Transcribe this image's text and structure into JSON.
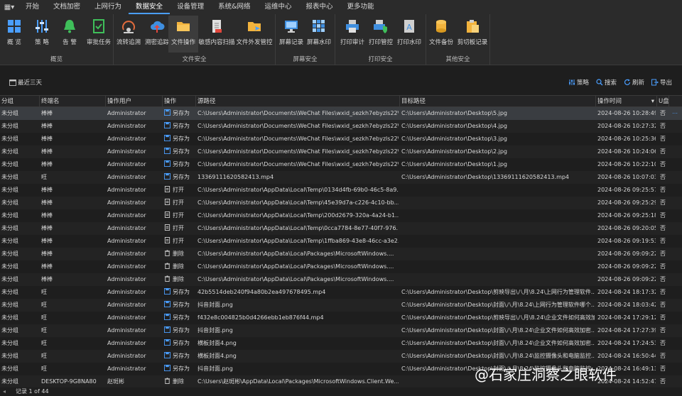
{
  "menu": {
    "items": [
      "开始",
      "文档加密",
      "上网行为",
      "数据安全",
      "设备管理",
      "系统&网络",
      "运维中心",
      "报表中心",
      "更多功能"
    ],
    "active_index": 3
  },
  "ribbon": {
    "groups": [
      {
        "label": "概览",
        "buttons": [
          {
            "label": "概 览",
            "icon": "grid-icon"
          },
          {
            "label": "策 略",
            "icon": "sliders-icon"
          },
          {
            "label": "告 警",
            "icon": "bell-icon"
          },
          {
            "label": "审批任务",
            "icon": "check-doc-icon"
          }
        ]
      },
      {
        "label": "文件安全",
        "buttons": [
          {
            "label": "流转追溯",
            "icon": "trace-icon"
          },
          {
            "label": "溯密追踪",
            "icon": "cloud-upload-icon"
          },
          {
            "label": "文件操作",
            "icon": "folder-icon"
          },
          {
            "label": "敏感内容扫描",
            "icon": "scan-doc-icon"
          },
          {
            "label": "文件外发管控",
            "icon": "folder-send-icon"
          }
        ]
      },
      {
        "label": "屏幕安全",
        "buttons": [
          {
            "label": "屏幕记录",
            "icon": "monitor-icon"
          },
          {
            "label": "屏幕水印",
            "icon": "mosaic-icon"
          }
        ]
      },
      {
        "label": "打印安全",
        "buttons": [
          {
            "label": "打印审计",
            "icon": "printer-icon"
          },
          {
            "label": "打印管控",
            "icon": "printer-shield-icon"
          },
          {
            "label": "打印水印",
            "icon": "doc-a-icon"
          }
        ]
      },
      {
        "label": "其他安全",
        "buttons": [
          {
            "label": "文件备份",
            "icon": "database-icon"
          },
          {
            "label": "剪切板记录",
            "icon": "clipboard-icon"
          }
        ]
      }
    ]
  },
  "toolbar": {
    "date_filter": "最近三天",
    "calendar_day": "25",
    "strategy": "策略",
    "search": "搜索",
    "refresh": "刷新",
    "export": "导出"
  },
  "table": {
    "columns": [
      "分组",
      "终端名",
      "操作用户",
      "操作",
      "源路径",
      "目标路径",
      "操作时间",
      "U盘"
    ],
    "rows": [
      [
        "未分组",
        "棒棒",
        "Administrator",
        "另存为",
        "C:\\Users\\Administrator\\Documents\\WeChat Files\\wxid_sezkh7ebyzls22\\...",
        "C:\\Users\\Administrator\\Desktop\\5.jpg",
        "2024-08-26 10:28:49",
        "否"
      ],
      [
        "未分组",
        "棒棒",
        "Administrator",
        "另存为",
        "C:\\Users\\Administrator\\Documents\\WeChat Files\\wxid_sezkh7ebyzls22\\...",
        "C:\\Users\\Administrator\\Desktop\\4.jpg",
        "2024-08-26 10:27:32",
        "否"
      ],
      [
        "未分组",
        "棒棒",
        "Administrator",
        "另存为",
        "C:\\Users\\Administrator\\Documents\\WeChat Files\\wxid_sezkh7ebyzls22\\...",
        "C:\\Users\\Administrator\\Desktop\\3.jpg",
        "2024-08-26 10:25:36",
        "否"
      ],
      [
        "未分组",
        "棒棒",
        "Administrator",
        "另存为",
        "C:\\Users\\Administrator\\Documents\\WeChat Files\\wxid_sezkh7ebyzls22\\...",
        "C:\\Users\\Administrator\\Desktop\\2.jpg",
        "2024-08-26 10:24:06",
        "否"
      ],
      [
        "未分组",
        "棒棒",
        "Administrator",
        "另存为",
        "C:\\Users\\Administrator\\Documents\\WeChat Files\\wxid_sezkh7ebyzls22\\...",
        "C:\\Users\\Administrator\\Desktop\\1.jpg",
        "2024-08-26 10:22:10",
        "否"
      ],
      [
        "未分组",
        "旺",
        "Administrator",
        "另存为",
        "13369111620582413.mp4",
        "C:\\Users\\Administrator\\Desktop\\13369111620582413.mp4",
        "2024-08-26 10:07:03",
        "否"
      ],
      [
        "未分组",
        "棒棒",
        "Administrator",
        "打开",
        "C:\\Users\\Administrator\\AppData\\Local\\Temp\\0134d4fb-69b0-46c5-8a9...",
        "",
        "2024-08-26 09:25:57",
        "否"
      ],
      [
        "未分组",
        "棒棒",
        "Administrator",
        "打开",
        "C:\\Users\\Administrator\\AppData\\Local\\Temp\\45e39d7a-c226-4c10-bb...",
        "",
        "2024-08-26 09:25:29",
        "否"
      ],
      [
        "未分组",
        "棒棒",
        "Administrator",
        "打开",
        "C:\\Users\\Administrator\\AppData\\Local\\Temp\\200d2679-320a-4a24-b1...",
        "",
        "2024-08-26 09:25:18",
        "否"
      ],
      [
        "未分组",
        "棒棒",
        "Administrator",
        "打开",
        "C:\\Users\\Administrator\\AppData\\Local\\Temp\\0cca7784-8e77-40f7-976...",
        "",
        "2024-08-26 09:20:05",
        "否"
      ],
      [
        "未分组",
        "棒棒",
        "Administrator",
        "打开",
        "C:\\Users\\Administrator\\AppData\\Local\\Temp\\1ffba869-43e8-46cc-a3e2...",
        "",
        "2024-08-26 09:19:53",
        "否"
      ],
      [
        "未分组",
        "棒棒",
        "Administrator",
        "删除",
        "C:\\Users\\Administrator\\AppData\\Local\\Packages\\MicrosoftWindows....",
        "",
        "2024-08-26 09:09:22",
        "否"
      ],
      [
        "未分组",
        "棒棒",
        "Administrator",
        "删除",
        "C:\\Users\\Administrator\\AppData\\Local\\Packages\\MicrosoftWindows....",
        "",
        "2024-08-26 09:09:22",
        "否"
      ],
      [
        "未分组",
        "棒棒",
        "Administrator",
        "删除",
        "C:\\Users\\Administrator\\AppData\\Local\\Packages\\MicrosoftWindows....",
        "",
        "2024-08-26 09:09:22",
        "否"
      ],
      [
        "未分组",
        "旺",
        "Administrator",
        "另存为",
        "42b5514deb240f94a80b2ea497678495.mp4",
        "C:\\Users\\Administrator\\Desktop\\剪映导出\\八月\\8.24\\上网行为管理软件...",
        "2024-08-24 18:17:32",
        "否"
      ],
      [
        "未分组",
        "旺",
        "Administrator",
        "另存为",
        "抖音封面.png",
        "C:\\Users\\Administrator\\Desktop\\封面\\八月\\8.24\\上网行为管理软件哪个...",
        "2024-08-24 18:03:42",
        "否"
      ],
      [
        "未分组",
        "旺",
        "Administrator",
        "另存为",
        "f432e8c004825b0d4266ebb1eb876f44.mp4",
        "C:\\Users\\Administrator\\Desktop\\剪映导出\\八月\\8.24\\企业文件如何高效加...",
        "2024-08-24 17:29:12",
        "否"
      ],
      [
        "未分组",
        "旺",
        "Administrator",
        "另存为",
        "抖音封面.png",
        "C:\\Users\\Administrator\\Desktop\\封面\\八月\\8.24\\企业文件如何高效加密...",
        "2024-08-24 17:27:39",
        "否"
      ],
      [
        "未分组",
        "旺",
        "Administrator",
        "另存为",
        "横板封面4.png",
        "C:\\Users\\Administrator\\Desktop\\封面\\八月\\8.24\\企业文件如何高效加密...",
        "2024-08-24 17:24:53",
        "否"
      ],
      [
        "未分组",
        "旺",
        "Administrator",
        "另存为",
        "横板封面4.png",
        "C:\\Users\\Administrator\\Desktop\\封面\\八月\\8.24\\监控摄像头和电脑监控...",
        "2024-08-24 16:50:44",
        "否"
      ],
      [
        "未分组",
        "旺",
        "Administrator",
        "另存为",
        "抖音封面.png",
        "C:\\Users\\Administrator\\Desktop\\封面\\八月\\8.24\\监控摄像头和电脑监控...",
        "2024-08-24 16:49:13",
        "否"
      ],
      [
        "未分组",
        "DESKTOP-9G8NA80",
        "赵斑彬",
        "删除",
        "C:\\Users\\赵斑彬\\AppData\\Local\\Packages\\MicrosoftWindows.Client.We...",
        "",
        "2024-08-24 14:52:47",
        "否"
      ]
    ],
    "selected_row": 0
  },
  "footer": {
    "pagination": "记录 1 of 44",
    "prev_glyph": "◂"
  },
  "watermark": "@石家庄洞察之眼软件",
  "colors": {
    "accent": "#4a9eff",
    "background": "#1e1e1e",
    "ribbon": "#2b2b2b"
  }
}
